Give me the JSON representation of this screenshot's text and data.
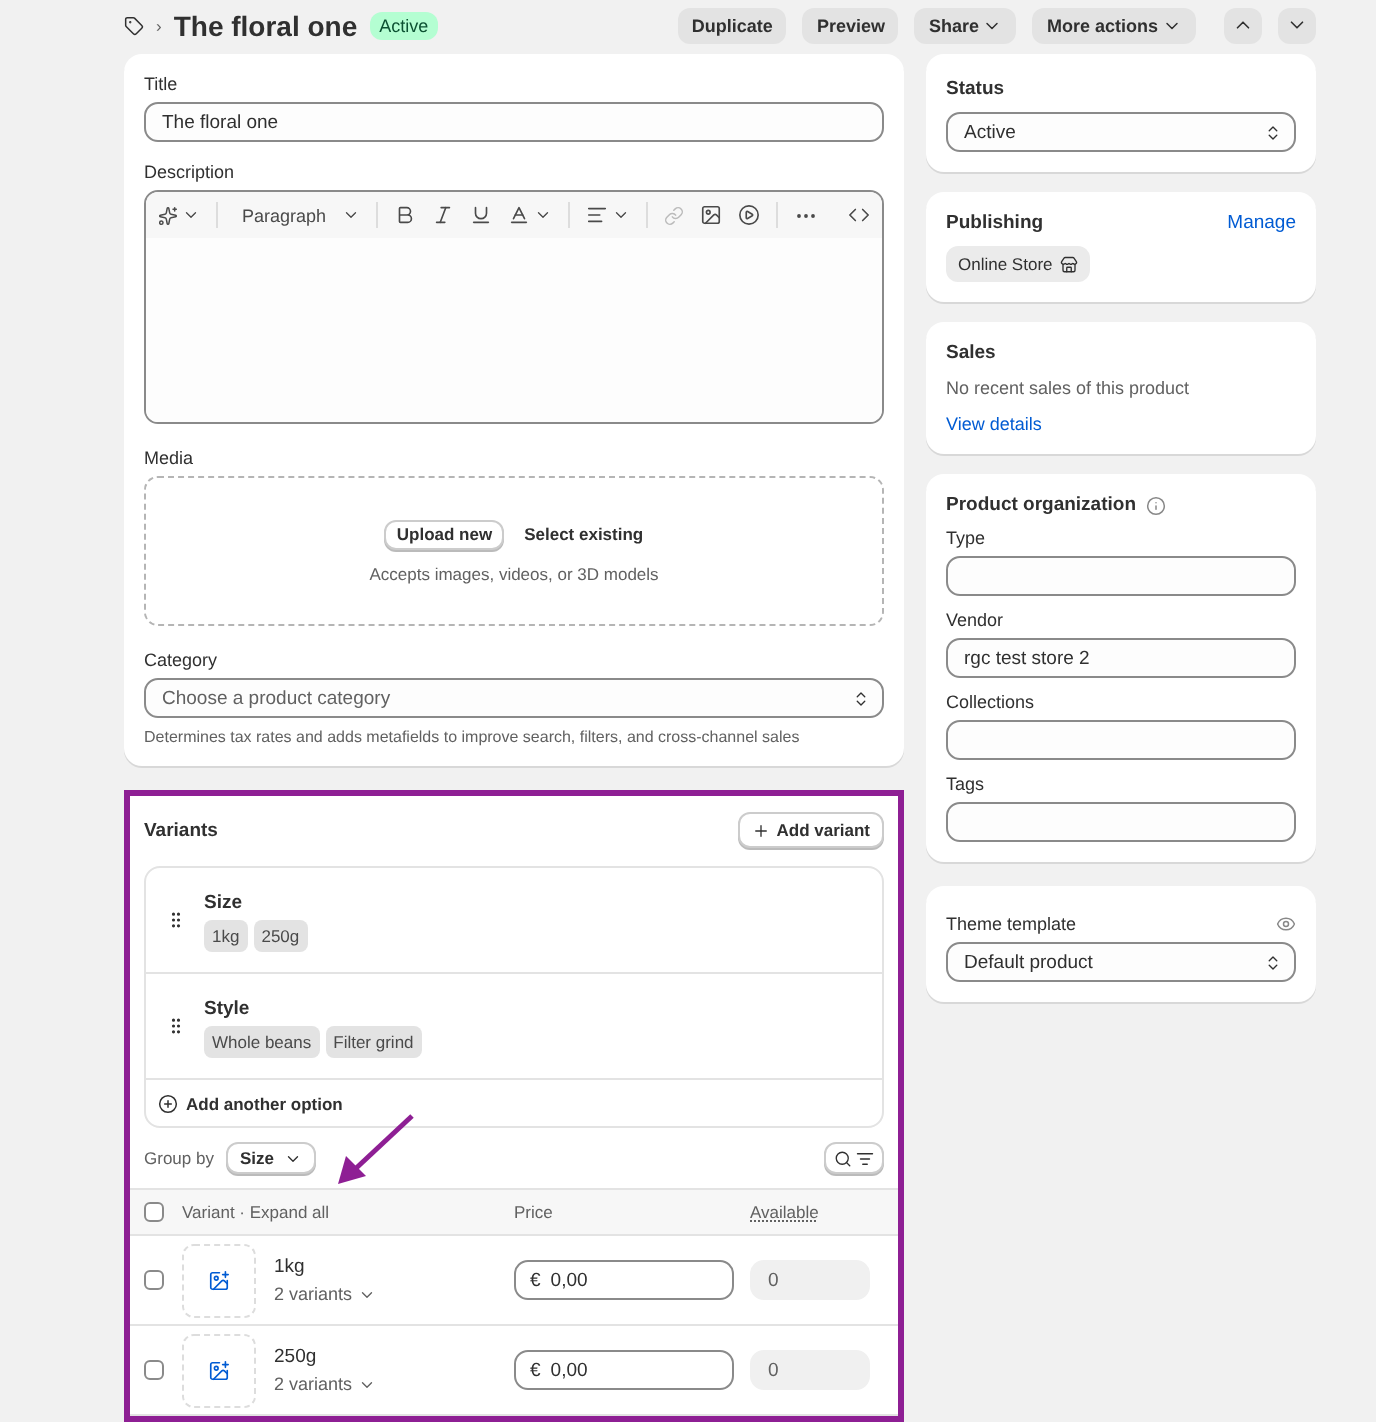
{
  "header": {
    "breadcrumb_separator": "›",
    "title": "The floral one",
    "badge": "Active",
    "actions": [
      {
        "label": "Duplicate",
        "dropdown": false
      },
      {
        "label": "Preview",
        "dropdown": false
      },
      {
        "label": "Share",
        "dropdown": true
      },
      {
        "label": "More actions",
        "dropdown": true
      }
    ]
  },
  "product": {
    "title_label": "Title",
    "title_value": "The floral one",
    "description_label": "Description",
    "paragraph_select": "Paragraph",
    "media_label": "Media",
    "upload_button": "Upload new",
    "select_existing": "Select existing",
    "media_hint": "Accepts images, videos, or 3D models",
    "category_label": "Category",
    "category_placeholder": "Choose a product category",
    "category_help": "Determines tax rates and adds metafields to improve search, filters, and cross-channel sales"
  },
  "variants": {
    "title": "Variants",
    "add_button": "Add variant",
    "highlighted": true,
    "options": [
      {
        "name": "Size",
        "values": [
          "1kg",
          "250g"
        ]
      },
      {
        "name": "Style",
        "values": [
          "Whole beans",
          "Filter grind"
        ]
      }
    ],
    "add_option": "Add another option",
    "group_by_label": "Group by",
    "group_by_value": "Size",
    "columns": [
      "Variant · Expand all",
      "Price",
      "Available"
    ],
    "rows": [
      {
        "name": "1kg",
        "count": "2 variants",
        "checked": false,
        "currency": "€",
        "price": "0,00",
        "available_placeholder": "0",
        "available_disabled": true
      },
      {
        "name": "250g",
        "count": "2 variants",
        "checked": false,
        "currency": "€",
        "price": "0,00",
        "available_placeholder": "0",
        "available_disabled": true
      }
    ]
  },
  "annotation": {
    "arrow": true
  },
  "sidebar": {
    "status": {
      "title": "Status",
      "value": "Active"
    },
    "publishing": {
      "title": "Publishing",
      "link": "Manage",
      "channel": "Online Store"
    },
    "sales": {
      "title": "Sales",
      "text": "No recent sales of this product",
      "link": "View details"
    },
    "organization": {
      "title": "Product organization",
      "fields": [
        {
          "label": "Type"
        },
        {
          "label": "Vendor",
          "value": "rgc test store 2"
        },
        {
          "label": "Collections"
        },
        {
          "label": "Tags"
        }
      ]
    },
    "theme": {
      "title": "Theme template",
      "value": "Default product"
    }
  }
}
